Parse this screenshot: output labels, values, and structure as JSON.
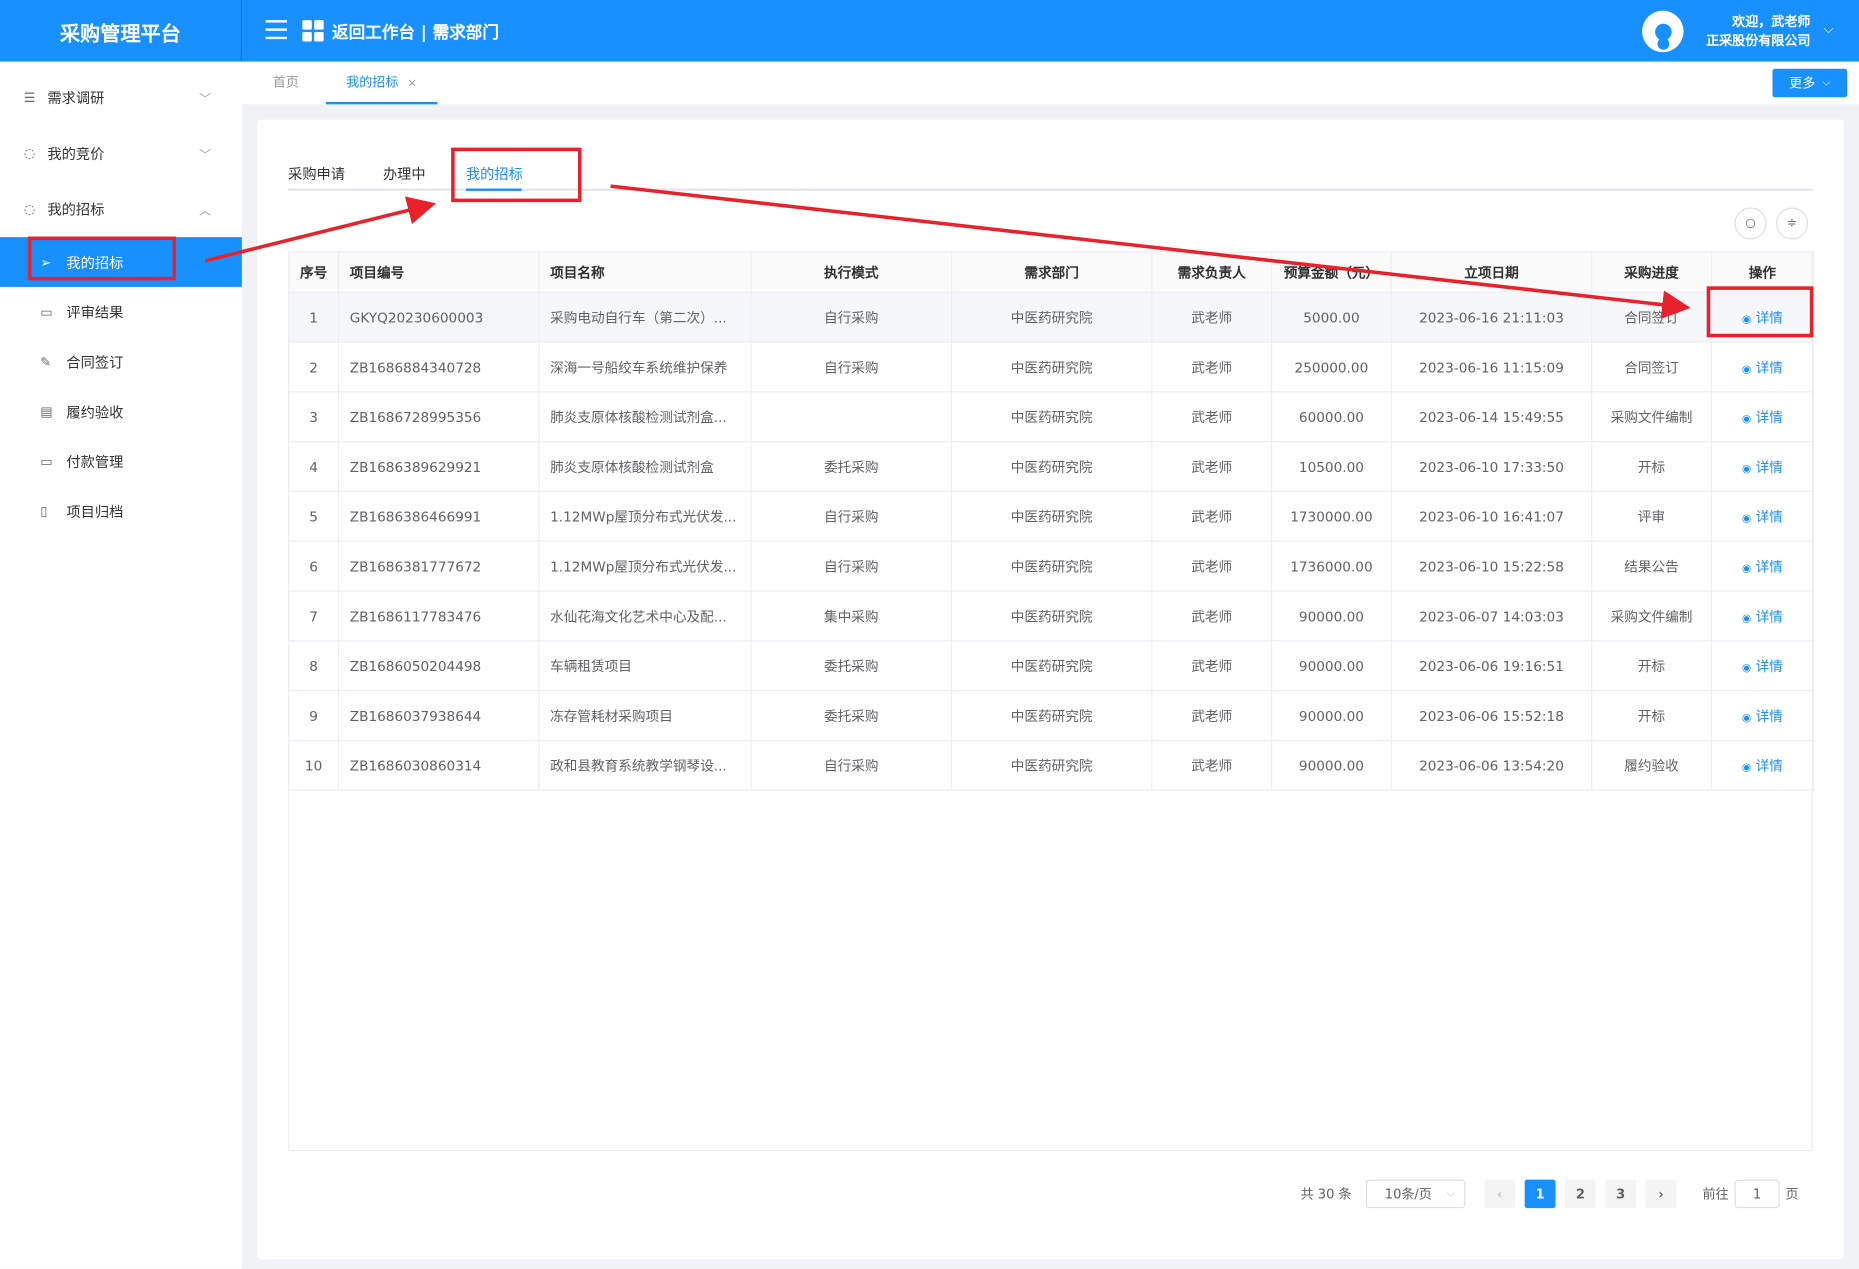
{
  "app": {
    "title": "采购管理平台",
    "nav_title": "返回工作台 | 需求部门",
    "welcome": "欢迎，武老师",
    "company": "正采股份有限公司"
  },
  "sidebar": {
    "items": [
      {
        "label": "需求调研",
        "icon": "list-icon"
      },
      {
        "label": "我的竞价",
        "icon": "coins-icon"
      },
      {
        "label": "我的招标",
        "icon": "coins-icon"
      }
    ],
    "subitems": [
      {
        "label": "我的招标",
        "icon": "send-icon",
        "active": true
      },
      {
        "label": "评审结果",
        "icon": "comment-icon"
      },
      {
        "label": "合同签订",
        "icon": "edit-icon"
      },
      {
        "label": "履约验收",
        "icon": "message-icon"
      },
      {
        "label": "付款管理",
        "icon": "monitor-icon"
      },
      {
        "label": "项目归档",
        "icon": "notebook-icon"
      }
    ]
  },
  "page_tabs": {
    "home": "首页",
    "current": "我的招标",
    "close": "×",
    "more": "更多"
  },
  "inner_tabs": [
    "采购申请",
    "办理中",
    "我的招标"
  ],
  "table": {
    "headers": [
      "序号",
      "项目编号",
      "项目名称",
      "执行模式",
      "需求部门",
      "需求负责人",
      "预算金额（元）",
      "立项日期",
      "采购进度",
      "操作"
    ],
    "rows": [
      [
        "1",
        "GKYQ20230600003",
        "采购电动自行车（第二次）...",
        "自行采购",
        "中医药研究院",
        "武老师",
        "5000.00",
        "2023-06-16 21:11:03",
        "合同签订",
        "详情"
      ],
      [
        "2",
        "ZB1686884340728",
        "深海一号船绞车系统维护保养",
        "自行采购",
        "中医药研究院",
        "武老师",
        "250000.00",
        "2023-06-16 11:15:09",
        "合同签订",
        "详情"
      ],
      [
        "3",
        "ZB1686728995356",
        "肺炎支原体核酸检测试剂盒...",
        "",
        "中医药研究院",
        "武老师",
        "60000.00",
        "2023-06-14 15:49:55",
        "采购文件编制",
        "详情"
      ],
      [
        "4",
        "ZB1686389629921",
        "肺炎支原体核酸检测试剂盒",
        "委托采购",
        "中医药研究院",
        "武老师",
        "10500.00",
        "2023-06-10 17:33:50",
        "开标",
        "详情"
      ],
      [
        "5",
        "ZB1686386466991",
        "1.12MWp屋顶分布式光伏发...",
        "自行采购",
        "中医药研究院",
        "武老师",
        "1730000.00",
        "2023-06-10 16:41:07",
        "评审",
        "详情"
      ],
      [
        "6",
        "ZB1686381777672",
        "1.12MWp屋顶分布式光伏发...",
        "自行采购",
        "中医药研究院",
        "武老师",
        "1736000.00",
        "2023-06-10 15:22:58",
        "结果公告",
        "详情"
      ],
      [
        "7",
        "ZB1686117783476",
        "水仙花海文化艺术中心及配...",
        "集中采购",
        "中医药研究院",
        "武老师",
        "90000.00",
        "2023-06-07 14:03:03",
        "采购文件编制",
        "详情"
      ],
      [
        "8",
        "ZB1686050204498",
        "车辆租赁项目",
        "委托采购",
        "中医药研究院",
        "武老师",
        "90000.00",
        "2023-06-06 19:16:51",
        "开标",
        "详情"
      ],
      [
        "9",
        "ZB1686037938644",
        "冻存管耗材采购项目",
        "委托采购",
        "中医药研究院",
        "武老师",
        "90000.00",
        "2023-06-06 15:52:18",
        "开标",
        "详情"
      ],
      [
        "10",
        "ZB1686030860314",
        "政和县教育系统教学钢琴设...",
        "自行采购",
        "中医药研究院",
        "武老师",
        "90000.00",
        "2023-06-06 13:54:20",
        "履约验收",
        "详情"
      ]
    ]
  },
  "pagination": {
    "total": "共 30 条",
    "page_size": "10条/页",
    "pages": [
      "1",
      "2",
      "3"
    ],
    "current": 1,
    "goto_prefix": "前往",
    "goto_value": "1",
    "goto_suffix": "页"
  },
  "colors": {
    "primary": "#1890ff",
    "annotation": "#e8212b"
  }
}
